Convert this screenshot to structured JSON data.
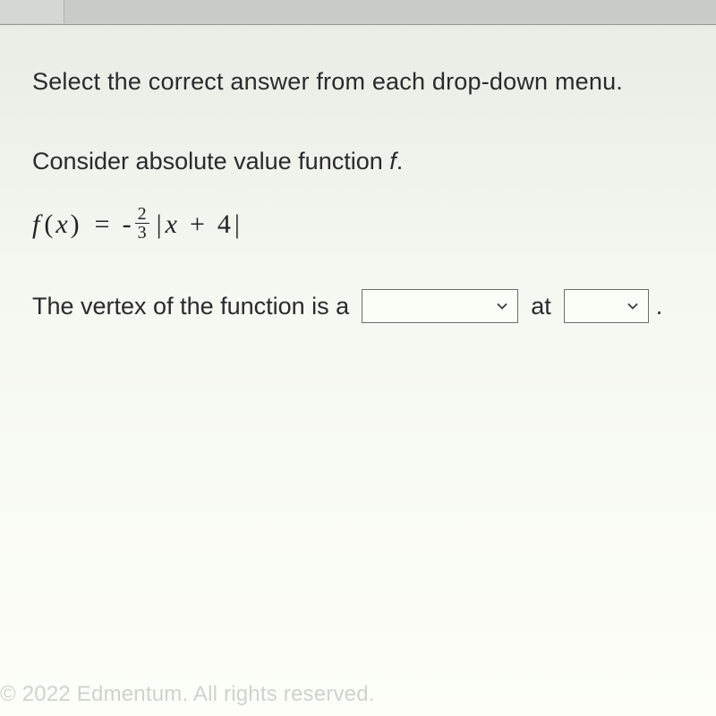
{
  "instruction": "Select the correct answer from each drop-down menu.",
  "consider_prefix": "Consider absolute value function ",
  "consider_var": "f",
  "consider_suffix": ".",
  "equation": {
    "func": "f",
    "arg": "x",
    "eq": "=",
    "neg": "-",
    "frac_num": "2",
    "frac_den": "3",
    "lbar": "|",
    "inner_x": "x",
    "plus": "+",
    "four": "4",
    "rbar": "|"
  },
  "sentence": {
    "part1": "The vertex of the function is a",
    "at": "at",
    "period": "."
  },
  "footer": "© 2022 Edmentum. All rights reserved."
}
